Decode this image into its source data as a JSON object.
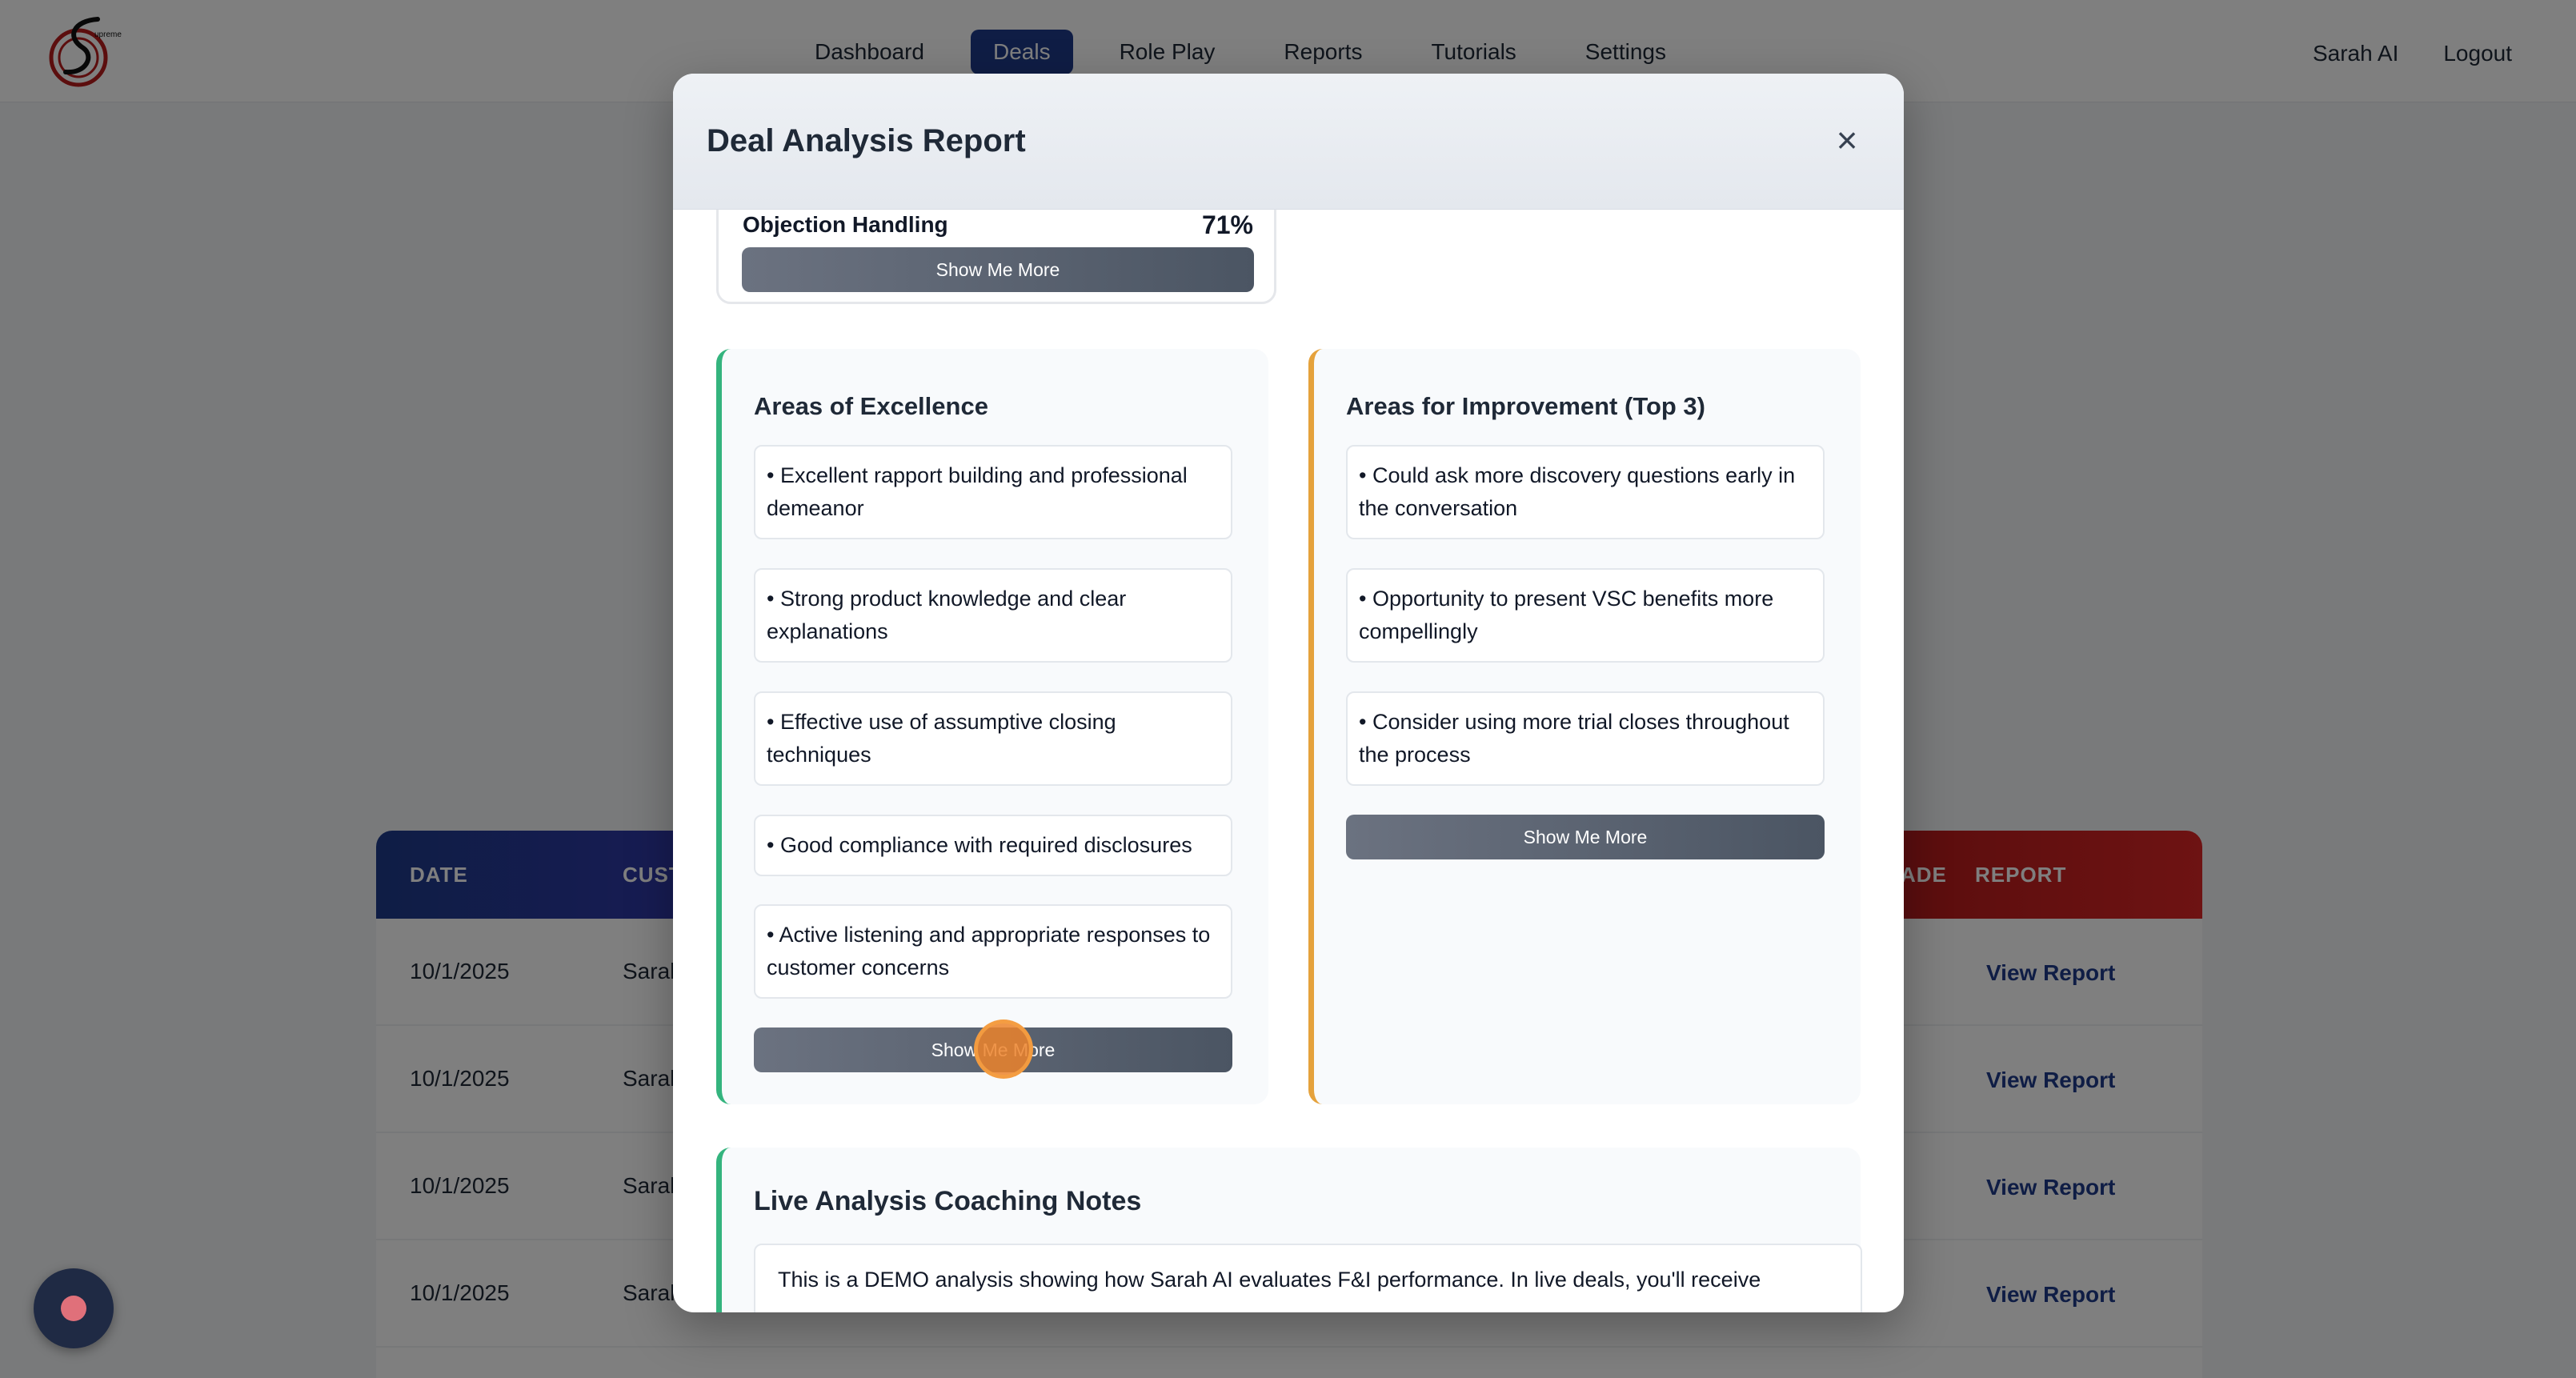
{
  "nav": {
    "links": [
      {
        "label": "Dashboard"
      },
      {
        "label": "Deals"
      },
      {
        "label": "Role Play"
      },
      {
        "label": "Reports"
      },
      {
        "label": "Tutorials"
      },
      {
        "label": "Settings"
      }
    ],
    "active": "Deals",
    "user": "Sarah AI",
    "logout": "Logout"
  },
  "table": {
    "headers": {
      "date": "DATE",
      "customer": "CUST",
      "grade": "ADE",
      "report": "REPORT"
    },
    "rows": [
      {
        "date": "10/1/2025",
        "customer": "Sarah",
        "report": "View Report"
      },
      {
        "date": "10/1/2025",
        "customer": "Sarah",
        "report": "View Report"
      },
      {
        "date": "10/1/2025",
        "customer": "Sarah",
        "report": "View Report"
      },
      {
        "date": "10/1/2025",
        "customer": "Sarah",
        "report": "View Report"
      }
    ]
  },
  "modal": {
    "title": "Deal Analysis Report",
    "close": "×",
    "score": {
      "label": "Objection Handling",
      "value": "71%"
    },
    "show_more": "Show Me More",
    "excellence": {
      "title": "Areas of Excellence",
      "items": [
        "• Excellent rapport building and professional demeanor",
        "• Strong product knowledge and clear explanations",
        "• Effective use of assumptive closing techniques",
        "• Good compliance with required disclosures",
        "• Active listening and appropriate responses to customer concerns"
      ]
    },
    "improvement": {
      "title": "Areas for Improvement (Top 3)",
      "items": [
        "• Could ask more discovery questions early in the conversation",
        "• Opportunity to present VSC benefits more compellingly",
        "• Consider using more trial closes throughout the process"
      ]
    },
    "coaching": {
      "title": "Live Analysis Coaching Notes",
      "text": "This is a DEMO analysis showing how Sarah AI evaluates F&I performance. In live deals, you'll receive"
    }
  },
  "colors": {
    "primary": "#1e3a8a",
    "excellence_accent": "#34b47e",
    "improvement_accent": "#e5a23c",
    "button": "#4b5563"
  }
}
